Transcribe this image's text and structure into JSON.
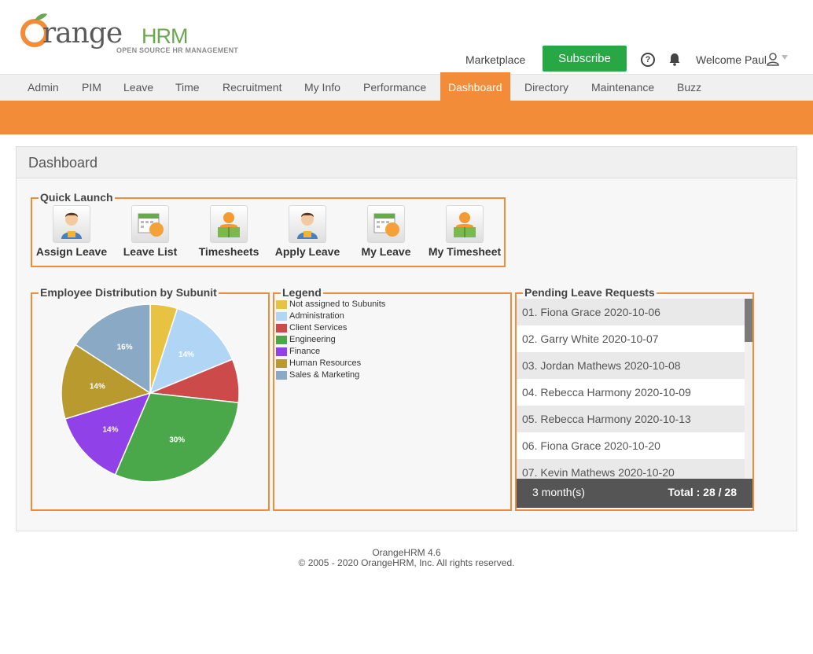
{
  "header": {
    "logo_word": "range",
    "logo_hrm": "HRM",
    "logo_tagline": "OPEN SOURCE HR MANAGEMENT",
    "marketplace": "Marketplace",
    "subscribe": "Subscribe",
    "welcome": "Welcome Paul"
  },
  "nav": {
    "tabs": [
      "Admin",
      "PIM",
      "Leave",
      "Time",
      "Recruitment",
      "My Info",
      "Performance",
      "Dashboard",
      "Directory",
      "Maintenance",
      "Buzz"
    ],
    "active": "Dashboard"
  },
  "dashboard": {
    "title": "Dashboard",
    "quick_launch": {
      "title": "Quick Launch",
      "items": [
        "Assign Leave",
        "Leave List",
        "Timesheets",
        "Apply Leave",
        "My Leave",
        "My Timesheet"
      ]
    },
    "employee_distribution": {
      "title": "Employee Distribution by Subunit"
    },
    "legend": {
      "title": "Legend"
    },
    "pending_leave": {
      "title": "Pending Leave Requests",
      "rows": [
        "01. Fiona Grace 2020-10-06",
        "02. Garry White 2020-10-07",
        "03. Jordan Mathews 2020-10-08",
        "04. Rebecca Harmony 2020-10-09",
        "05. Rebecca Harmony 2020-10-13",
        "06. Fiona Grace 2020-10-20",
        "07. Kevin Mathews 2020-10-20"
      ],
      "period": "3 month(s)",
      "total": "Total : 28 / 28"
    }
  },
  "chart_data": {
    "type": "pie",
    "title": "Employee Distribution by Subunit",
    "series": [
      {
        "name": "Not assigned to Subunits",
        "value": 5,
        "color": "#e8c242",
        "label": ""
      },
      {
        "name": "Administration",
        "value": 14,
        "color": "#b1d6f5",
        "label": "14%"
      },
      {
        "name": "Client Services",
        "value": 8,
        "color": "#cc4a4a",
        "label": ""
      },
      {
        "name": "Engineering",
        "value": 30,
        "color": "#4aa84a",
        "label": "30%"
      },
      {
        "name": "Finance",
        "value": 14,
        "color": "#9141e8",
        "label": "14%"
      },
      {
        "name": "Human Resources",
        "value": 14,
        "color": "#b89a2e",
        "label": "14%"
      },
      {
        "name": "Sales & Marketing",
        "value": 16,
        "color": "#8aa9c4",
        "label": "16%"
      }
    ]
  },
  "footer": {
    "version": "OrangeHRM 4.6",
    "copyright": "© 2005 - 2020 OrangeHRM, Inc. All rights reserved."
  },
  "colors": {
    "accent": "#f28c38",
    "subscribe": "#28a745",
    "logo_green": "#6aa84f"
  }
}
